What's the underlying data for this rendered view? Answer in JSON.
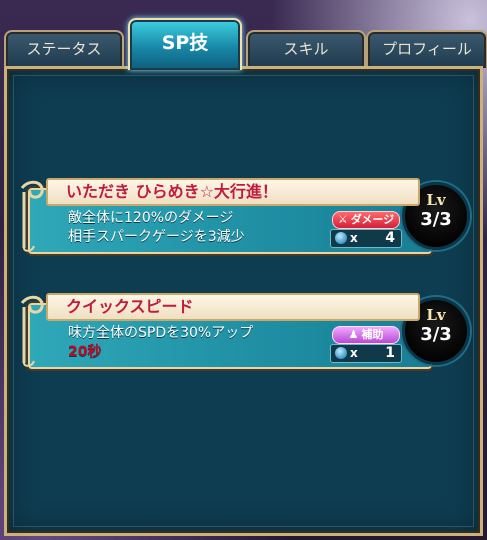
{
  "tabs": [
    {
      "label": "ステータス",
      "active": false
    },
    {
      "label": "SP技",
      "active": true
    },
    {
      "label": "スキル",
      "active": false
    },
    {
      "label": "プロフィール",
      "active": false
    }
  ],
  "skills": [
    {
      "name": "いただき ひらめき☆大行進！",
      "desc_line1": "敵全体に120%のダメージ",
      "desc_line2": "相手スパークゲージを3減少",
      "duration": "",
      "type_label": "ダメージ",
      "type_icon": "sword-icon",
      "gauge_x": "x",
      "gauge_value": "4",
      "lv_label": "Lv",
      "lv_value": "3/3"
    },
    {
      "name": "クイックスピード",
      "desc_line1": "味方全体のSPDを30%アップ",
      "desc_line2": "",
      "duration": "20秒",
      "type_label": "補助",
      "type_icon": "person-icon",
      "gauge_x": "x",
      "gauge_value": "1",
      "lv_label": "Lv",
      "lv_value": "3/3"
    }
  ],
  "colors": {
    "panel": "#0e3c50",
    "card": "#1f8ea3",
    "title_text": "#c21a3a",
    "damage_badge": "#d3203a",
    "support_badge": "#b64ad3"
  }
}
